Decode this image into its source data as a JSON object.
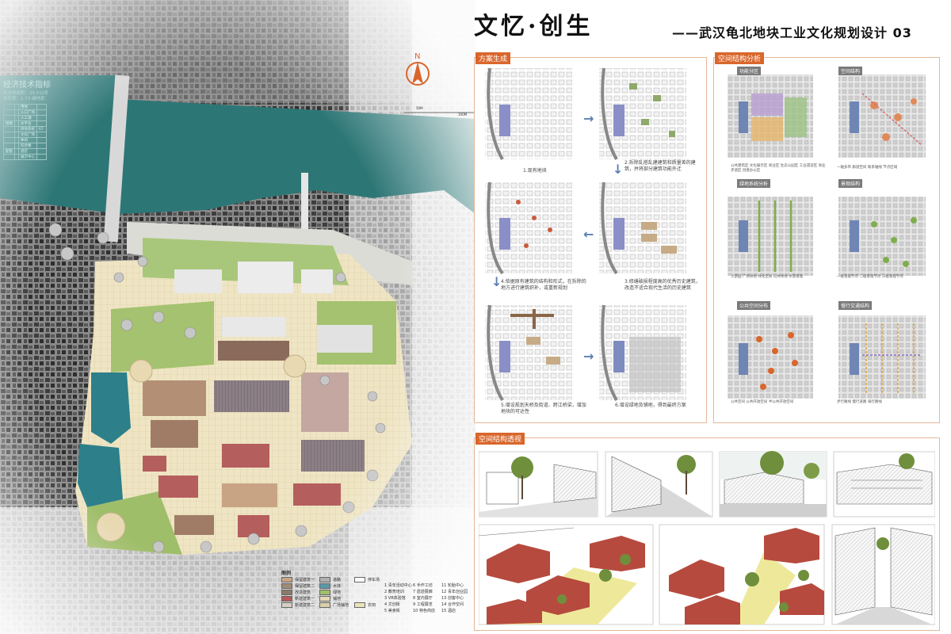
{
  "title": {
    "main": "文忆·创生",
    "sub": "——武汉龟北地块工业文化规划设计 03"
  },
  "master_plan": {
    "compass": "N",
    "scale_label_1": "50M",
    "scale_label_2": "100M",
    "stats": {
      "title": "经济技术指标",
      "line1": "总用地面积：25.5公顷",
      "line2": "容积率：1.73   绿地率：",
      "rows": [
        [
          "",
          "",
          "用地",
          "",
          ""
        ],
        [
          "",
          "",
          "入口广场",
          "",
          ""
        ],
        [
          "",
          "",
          "人工湖",
          "",
          ""
        ],
        [
          "场地",
          "",
          "水平台",
          "",
          ""
        ],
        [
          "",
          "",
          "绿地系统",
          "67.",
          ""
        ],
        [
          "",
          "",
          "文化广场",
          "",
          ""
        ],
        [
          "",
          "",
          "休闲",
          "",
          ""
        ],
        [
          "",
          "",
          "综合楼",
          "",
          ""
        ],
        [
          "配套",
          "",
          "酒店",
          "",
          ""
        ],
        [
          "",
          "",
          "展示中心",
          "",
          ""
        ]
      ]
    },
    "legend": {
      "title": "图例",
      "col1": [
        "保留建筑一",
        "保留建筑二",
        "改造建筑",
        "新建建筑一",
        "新建建筑二"
      ],
      "col1_colors": [
        "#c8a484",
        "#a08b74",
        "#8d7a6a",
        "#b45a5a",
        "#d6cfc4"
      ],
      "col2": [
        "道路",
        "水体",
        "绿地",
        "铺地",
        "广场铺地"
      ],
      "col2_colors": [
        "#b0b0b0",
        "#5a98a8",
        "#9fbf6a",
        "#e5d8b8",
        "#d9cfa8"
      ],
      "col3": [
        "停车场",
        "",
        "",
        "",
        "农田"
      ],
      "col4": [
        "1 青年活动中心",
        "2 教育培训",
        "3 VR体验馆",
        "4 文创街",
        "5 美食街"
      ],
      "col5": [
        "6 手作工坊",
        "7 遗迹展廊",
        "8 室内展厅",
        "9 工程展览",
        "10 特色商店"
      ],
      "col6": [
        "11 轮胎中心",
        "12 青年创业园",
        "13 创客中心",
        "14 合作空间",
        "15 酒店"
      ]
    }
  },
  "scheme": {
    "tag": "方案生成",
    "steps": [
      "1.现有地块",
      "2.拆除乱搭乱建建筑和质量差的建筑，并将部分建筑功能外迁",
      "3.修缮破损程度高的优秀历史建筑，改造不适合现代生活的历史建筑",
      "4.依据原有建筑的结构和形式，在拆除的地方进行建筑织补，或重新规划",
      "5.增设规划天桥及街道、跨江桥梁，增加地块的可达性",
      "6.增设绿地及铺地，得到最终方案"
    ]
  },
  "space_analysis": {
    "tag": "空间结构分析",
    "blocks": [
      {
        "title": "功能分区",
        "legend": "公共建筑区  文化展示区  商业区  生态公园区  工业遗迹区  商业步道区  创意办公区"
      },
      {
        "title": "空间结构",
        "legend": "一轴多带  廊道空间  联系轴线  节点区域"
      },
      {
        "title": "绿地系统分析",
        "legend": "小游园  广场绿地  绿化空间  公共绿地  水景景观"
      },
      {
        "title": "景观结构",
        "legend": "一级景观节点  二级景观节点  三级景观节点"
      },
      {
        "title": "公共空间分布",
        "legend": "公共空间  公共开放空间  半公共开放空间"
      },
      {
        "title": "慢行交通结构",
        "legend": "步行路线  慢行道路  骑行路线"
      }
    ]
  },
  "perspective": {
    "tag": "空间结构透视"
  },
  "colors": {
    "accent": "#d9662b",
    "water": "#2d7676",
    "panel_border": "#e3b898"
  }
}
